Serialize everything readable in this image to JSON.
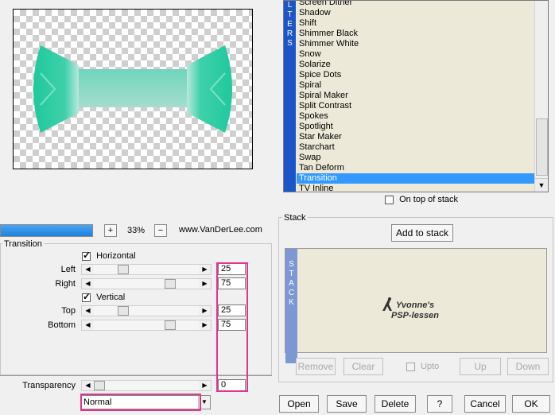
{
  "colors": {
    "highlight": "#3399ff",
    "accent_pink": "#e0358c",
    "list_bg": "#ece9d8",
    "filters_band": "#1c55c7"
  },
  "filters": {
    "vertical_label": "LTERS",
    "items": [
      "Screen Dither",
      "Shadow",
      "Shift",
      "Shimmer Black",
      "Shimmer White",
      "Snow",
      "Solarize",
      "Spice Dots",
      "Spiral",
      "Spiral Maker",
      "Split Contrast",
      "Spokes",
      "Spotlight",
      "Star Maker",
      "Starchart",
      "Swap",
      "Tan Deform",
      "Transition",
      "TV Inline"
    ],
    "selected_index": 17,
    "on_top_label": "On top of stack",
    "on_top_checked": false
  },
  "zoom": {
    "minus_label": "−",
    "plus_label": "+",
    "value": "33%",
    "progress_fraction": 1.0
  },
  "site_url": "www.VanDerLee.com",
  "transition": {
    "group_title": "Transition",
    "horizontal": {
      "label": "Horizontal",
      "checked": true
    },
    "vertical": {
      "label": "Vertical",
      "checked": true
    },
    "left": {
      "label": "Left",
      "value": "25",
      "fraction": 0.25
    },
    "right": {
      "label": "Right",
      "value": "75",
      "fraction": 0.75
    },
    "top": {
      "label": "Top",
      "value": "25",
      "fraction": 0.25
    },
    "bottom": {
      "label": "Bottom",
      "value": "75",
      "fraction": 0.75
    }
  },
  "transparency": {
    "label": "Transparency",
    "value": "0",
    "fraction": 0
  },
  "blend_mode": {
    "value": "Normal"
  },
  "stack": {
    "group_title": "Stack",
    "vertical_label": "STACK",
    "add_button": "Add to stack",
    "remove_button": "Remove",
    "clear_button": "Clear",
    "upto_label": "Upto",
    "up_button": "Up",
    "down_button": "Down",
    "watermark_line1": "Yvonne's",
    "watermark_line2": "PSP-lessen"
  },
  "footer": {
    "open": "Open",
    "save": "Save",
    "delete": "Delete",
    "help": "?",
    "cancel": "Cancel",
    "ok": "OK"
  }
}
